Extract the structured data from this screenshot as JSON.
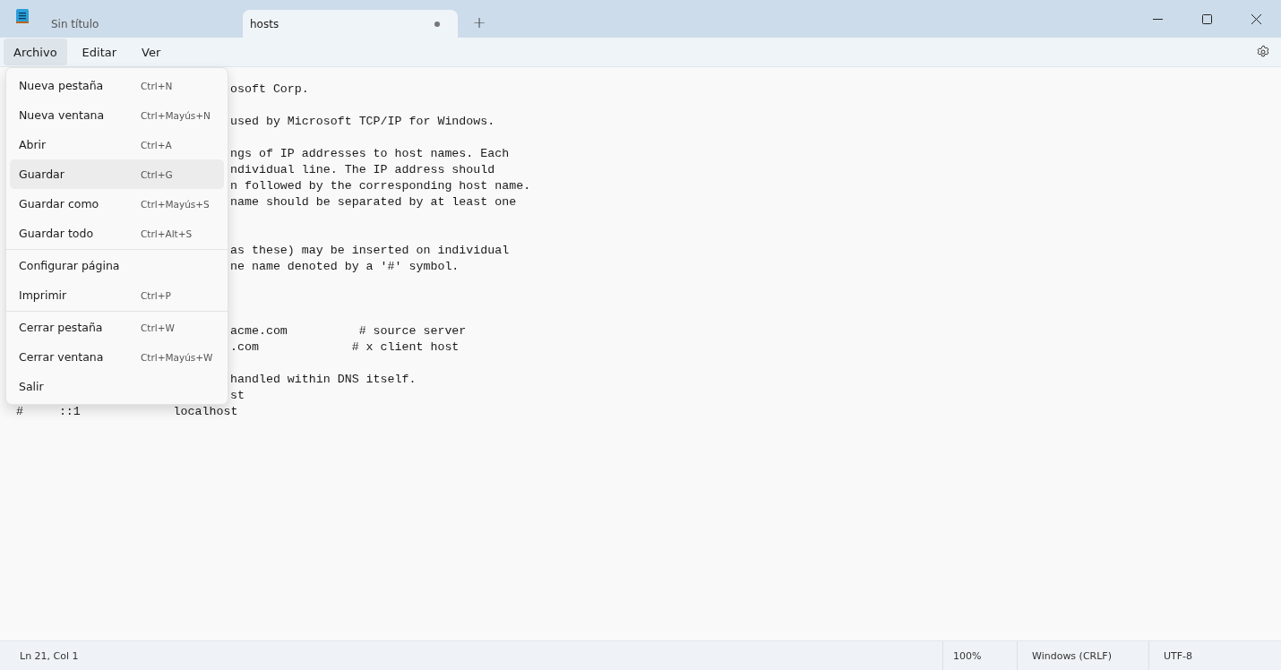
{
  "tabs": [
    {
      "label": "Sin título",
      "selected": false,
      "modified": false
    },
    {
      "label": "hosts",
      "selected": true,
      "modified": true
    }
  ],
  "new_tab_button": "+",
  "menubar": [
    {
      "label": "Archivo",
      "selected": true
    },
    {
      "label": "Editar",
      "selected": false
    },
    {
      "label": "Ver",
      "selected": false
    }
  ],
  "file_menu": {
    "groups": [
      [
        {
          "label": "Nueva pestaña",
          "shortcut": "Ctrl+N",
          "hovered": false
        },
        {
          "label": "Nueva ventana",
          "shortcut": "Ctrl+Mayús+N",
          "hovered": false
        },
        {
          "label": "Abrir",
          "shortcut": "Ctrl+A",
          "hovered": false
        },
        {
          "label": "Guardar",
          "shortcut": "Ctrl+G",
          "hovered": true
        },
        {
          "label": "Guardar como",
          "shortcut": "Ctrl+Mayús+S",
          "hovered": false
        },
        {
          "label": "Guardar todo",
          "shortcut": "Ctrl+Alt+S",
          "hovered": false
        }
      ],
      [
        {
          "label": "Configurar página",
          "hovered": false
        },
        {
          "label": "Imprimir",
          "shortcut": "Ctrl+P",
          "hovered": false
        }
      ],
      [
        {
          "label": "Cerrar pestaña",
          "shortcut": "Ctrl+W",
          "hovered": false
        },
        {
          "label": "Cerrar ventana",
          "shortcut": "Ctrl+Mayús+W",
          "hovered": false
        },
        {
          "label": "Salir",
          "hovered": false
        }
      ]
    ]
  },
  "editor": {
    "paragraphs_beside_menu": [
      [
        "osoft Corp."
      ],
      [
        "used by Microsoft TCP/IP for Windows."
      ],
      [
        "ngs of IP addresses to host names. Each",
        "ndividual line. The IP address should",
        "n followed by the corresponding host name.",
        "name should be separated by at least one"
      ],
      [
        "as these) may be inserted on individual",
        "ne name denoted by a '#' symbol."
      ],
      [
        "acme.com          # source server",
        ".com             # x client host"
      ],
      [
        "handled within DNS itself.",
        "st"
      ]
    ],
    "lines_below_menu": [
      "#\t::1             localhost"
    ]
  },
  "status_bar": {
    "position": "Ln 21, Col 1",
    "zoom": "100%",
    "line_ending": "Windows (CRLF)",
    "encoding": "UTF-8"
  }
}
